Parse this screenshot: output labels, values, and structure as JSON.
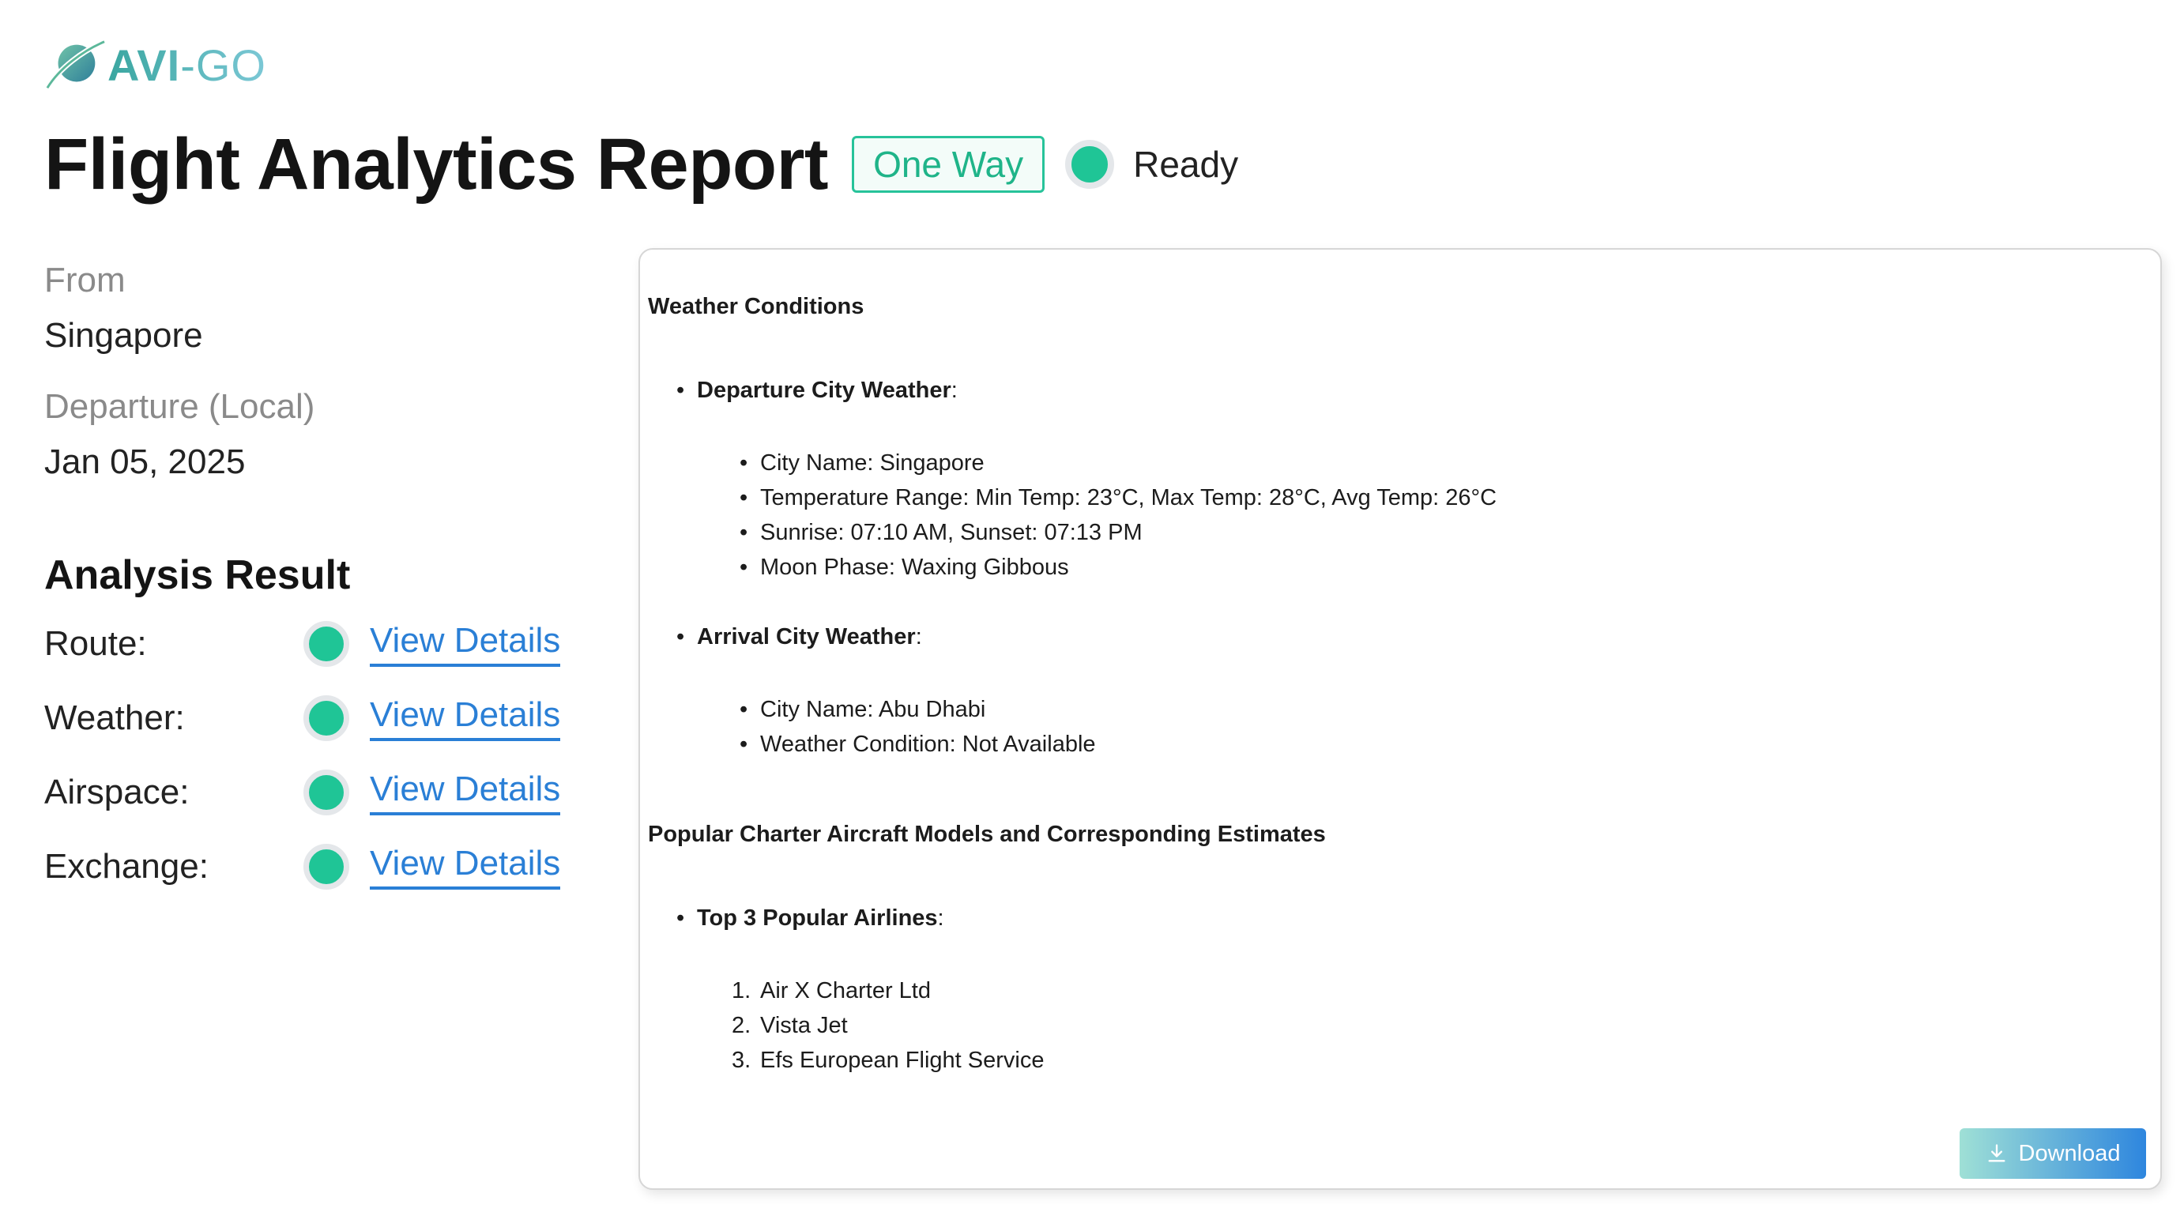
{
  "logo": {
    "text_main": "AVI",
    "text_sep": "-",
    "text_go": "GO"
  },
  "header": {
    "title": "Flight Analytics Report",
    "trip_type": "One Way",
    "status": "Ready"
  },
  "trip": {
    "from_label": "From",
    "from_value": "Singapore",
    "departure_label": "Departure (Local)",
    "departure_value": "Jan 05, 2025"
  },
  "analysis": {
    "title": "Analysis Result",
    "rows": [
      {
        "label": "Route:",
        "link": "View Details"
      },
      {
        "label": "Weather:",
        "link": "View Details"
      },
      {
        "label": "Airspace:",
        "link": "View Details"
      },
      {
        "label": "Exchange:",
        "link": "View Details"
      }
    ]
  },
  "report": {
    "weather_heading": "Weather Conditions",
    "departure": {
      "heading": "Departure City Weather",
      "items": [
        "City Name: Singapore",
        "Temperature Range: Min Temp: 23°C, Max Temp: 28°C, Avg Temp: 26°C",
        "Sunrise: 07:10 AM, Sunset: 07:13 PM",
        "Moon Phase: Waxing Gibbous"
      ]
    },
    "arrival": {
      "heading": "Arrival City Weather",
      "items": [
        "City Name: Abu Dhabi",
        "Weather Condition: Not Available"
      ]
    },
    "charter_heading": "Popular Charter Aircraft Models and Corresponding Estimates",
    "airlines": {
      "heading": "Top 3 Popular Airlines",
      "items": [
        "Air X Charter Ltd",
        "Vista Jet",
        "Efs European Flight Service"
      ]
    },
    "download_label": "Download"
  },
  "icons": {
    "logo": "plane-orbit-icon",
    "download": "download-icon",
    "status": "status-dot"
  },
  "colors": {
    "accent_green": "#1fc596",
    "link_blue": "#2a7fd6",
    "badge_border": "#27c39a"
  }
}
